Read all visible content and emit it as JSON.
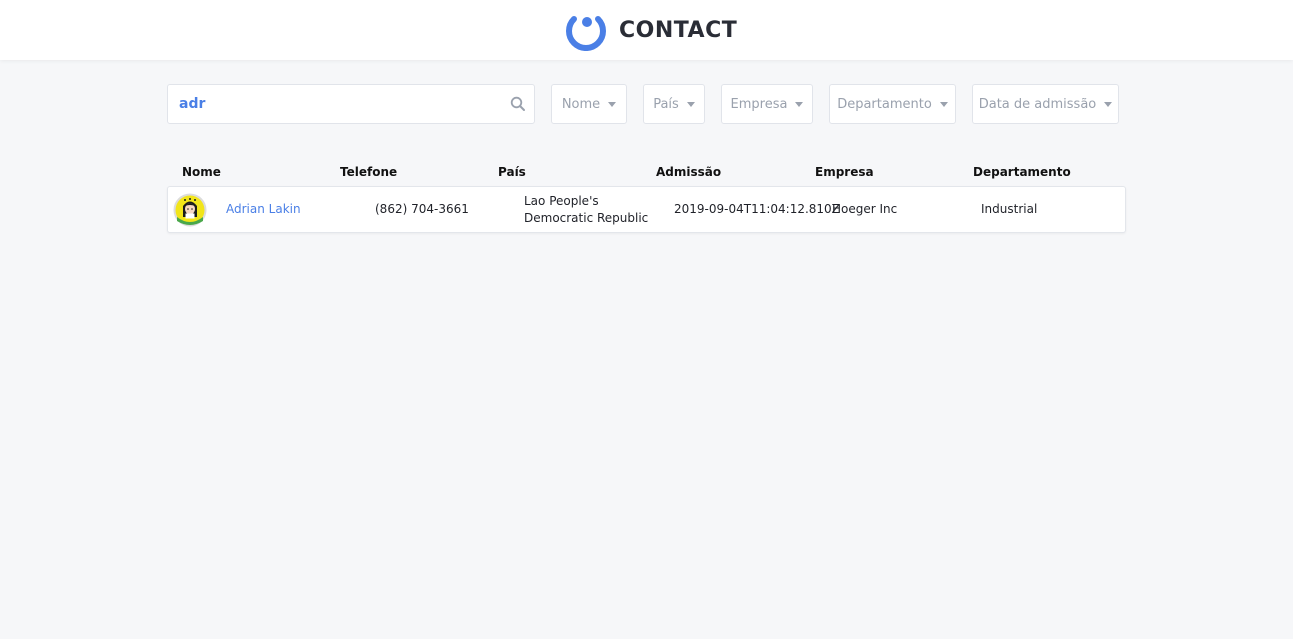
{
  "app": {
    "title": "CONTACT",
    "accent_color": "#4a7fe6"
  },
  "search": {
    "value": "adr",
    "placeholder": "",
    "icon": "search-icon"
  },
  "filters": {
    "nome": "Nome",
    "pais": "País",
    "empresa": "Empresa",
    "departamento": "Departamento",
    "data_admissao": "Data de admissão"
  },
  "table": {
    "headers": {
      "nome": "Nome",
      "telefone": "Telefone",
      "pais": "País",
      "admissao": "Admissão",
      "empresa": "Empresa",
      "departamento": "Departamento"
    },
    "rows": [
      {
        "avatar": "avatar-image",
        "nome": "Adrian Lakin",
        "telefone": "(862) 704-3661",
        "pais_line1": "Lao People's",
        "pais_line2": "Democratic Republic",
        "admissao": "2019-09-04T11:04:12.810Z",
        "empresa": "Hoeger Inc",
        "departamento": "Industrial"
      }
    ]
  }
}
